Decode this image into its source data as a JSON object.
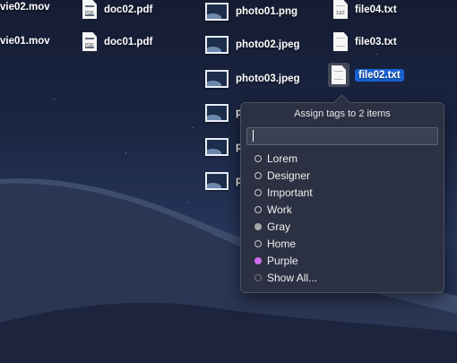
{
  "desktop": {
    "files": [
      {
        "id": "movie02",
        "label": "vie02.mov",
        "type": "movie"
      },
      {
        "id": "doc02",
        "label": "doc02.pdf",
        "type": "pdf"
      },
      {
        "id": "photo01",
        "label": "photo01.png",
        "type": "image"
      },
      {
        "id": "file04",
        "label": "file04.txt",
        "type": "txt"
      },
      {
        "id": "movie01",
        "label": "vie01.mov",
        "type": "movie"
      },
      {
        "id": "doc01",
        "label": "doc01.pdf",
        "type": "pdf"
      },
      {
        "id": "photo02",
        "label": "photo02.jpeg",
        "type": "image"
      },
      {
        "id": "file03",
        "label": "file03.txt",
        "type": "txt"
      },
      {
        "id": "photo03",
        "label": "photo03.jpeg",
        "type": "image"
      },
      {
        "id": "file02",
        "label": "file02.txt",
        "type": "txt",
        "selected": true
      },
      {
        "id": "photo04",
        "label": "p",
        "type": "image"
      },
      {
        "id": "photo05",
        "label": "p",
        "type": "image"
      },
      {
        "id": "photo06",
        "label": "p",
        "type": "image"
      }
    ],
    "pdf_badge": "PDF",
    "txt_badge": "TXT"
  },
  "popover": {
    "title": "Assign tags to 2 items",
    "input_value": "",
    "tags": [
      {
        "label": "Lorem",
        "color": "none"
      },
      {
        "label": "Designer",
        "color": "none"
      },
      {
        "label": "Important",
        "color": "none"
      },
      {
        "label": "Work",
        "color": "none"
      },
      {
        "label": "Gray",
        "color": "#a7a7a7"
      },
      {
        "label": "Home",
        "color": "none"
      },
      {
        "label": "Purple",
        "color": "#cf6cf0"
      }
    ],
    "show_all": "Show All..."
  }
}
